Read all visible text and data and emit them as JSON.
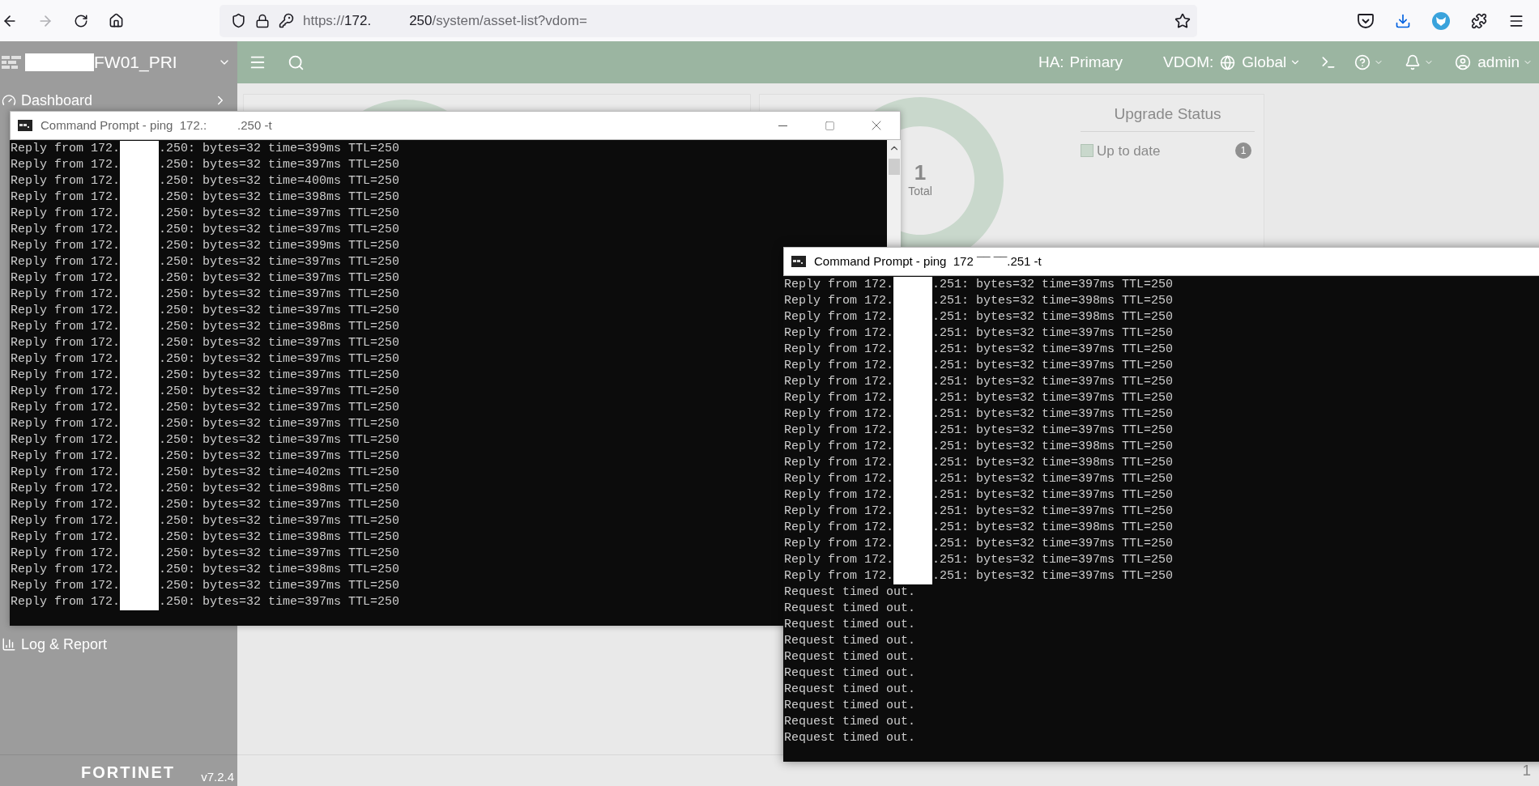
{
  "browser": {
    "forward_disabled": true,
    "url_scheme": "https://",
    "url_host_start": "172.",
    "url_host_end": "250",
    "url_path": "/system/asset-list?vdom="
  },
  "header": {
    "hostname": "FW01_PRI",
    "ha_label": "HA:",
    "ha_value": "Primary",
    "vdom_label": "VDOM:",
    "vdom_value": "Global",
    "user": "admin"
  },
  "sidebar": {
    "items": [
      {
        "label": "Dashboard"
      },
      {
        "label": "Log & Report"
      }
    ],
    "logo_text": "FORTINET",
    "version": "v7.2.4"
  },
  "upgrade_card": {
    "total": "1",
    "total_label": "Total",
    "legend_title": "Upgrade Status",
    "legend": [
      {
        "label": "Up to date",
        "count": "1",
        "checked": false
      }
    ]
  },
  "page_footer": {
    "count": "1"
  },
  "windows": [
    {
      "title_parts": [
        "Command Prompt - ping  172.:",
        ".250 -t"
      ],
      "active": false,
      "lines": [
        {
          "kind": "redacted",
          "start": "Reply from 172.",
          "end": ".250: bytes=32 time=399ms TTL=250"
        },
        {
          "kind": "redacted",
          "start": "Reply from 172.",
          "end": ".250: bytes=32 time=397ms TTL=250"
        },
        {
          "kind": "redacted",
          "start": "Reply from 172.",
          "end": ".250: bytes=32 time=400ms TTL=250"
        },
        {
          "kind": "redacted",
          "start": "Reply from 172.",
          "end": ".250: bytes=32 time=398ms TTL=250"
        },
        {
          "kind": "redacted",
          "start": "Reply from 172.",
          "end": ".250: bytes=32 time=397ms TTL=250"
        },
        {
          "kind": "redacted",
          "start": "Reply from 172.",
          "end": ".250: bytes=32 time=397ms TTL=250"
        },
        {
          "kind": "redacted",
          "start": "Reply from 172.",
          "end": ".250: bytes=32 time=399ms TTL=250"
        },
        {
          "kind": "redacted",
          "start": "Reply from 172.",
          "end": ".250: bytes=32 time=397ms TTL=250"
        },
        {
          "kind": "redacted",
          "start": "Reply from 172.",
          "end": ".250: bytes=32 time=397ms TTL=250"
        },
        {
          "kind": "redacted",
          "start": "Reply from 172.",
          "end": ".250: bytes=32 time=397ms TTL=250"
        },
        {
          "kind": "redacted",
          "start": "Reply from 172.",
          "end": ".250: bytes=32 time=397ms TTL=250"
        },
        {
          "kind": "redacted",
          "start": "Reply from 172.",
          "end": ".250: bytes=32 time=398ms TTL=250"
        },
        {
          "kind": "redacted",
          "start": "Reply from 172.",
          "end": ".250: bytes=32 time=397ms TTL=250"
        },
        {
          "kind": "redacted",
          "start": "Reply from 172.",
          "end": ".250: bytes=32 time=397ms TTL=250"
        },
        {
          "kind": "redacted",
          "start": "Reply from 172.",
          "end": ".250: bytes=32 time=397ms TTL=250"
        },
        {
          "kind": "redacted",
          "start": "Reply from 172.",
          "end": ".250: bytes=32 time=397ms TTL=250"
        },
        {
          "kind": "redacted",
          "start": "Reply from 172.",
          "end": ".250: bytes=32 time=397ms TTL=250"
        },
        {
          "kind": "redacted",
          "start": "Reply from 172.",
          "end": ".250: bytes=32 time=397ms TTL=250"
        },
        {
          "kind": "redacted",
          "start": "Reply from 172.",
          "end": ".250: bytes=32 time=397ms TTL=250"
        },
        {
          "kind": "redacted",
          "start": "Reply from 172.",
          "end": ".250: bytes=32 time=397ms TTL=250"
        },
        {
          "kind": "redacted",
          "start": "Reply from 172.",
          "end": ".250: bytes=32 time=402ms TTL=250"
        },
        {
          "kind": "redacted",
          "start": "Reply from 172.",
          "end": ".250: bytes=32 time=398ms TTL=250"
        },
        {
          "kind": "redacted",
          "start": "Reply from 172.",
          "end": ".250: bytes=32 time=397ms TTL=250"
        },
        {
          "kind": "redacted",
          "start": "Reply from 172.",
          "end": ".250: bytes=32 time=397ms TTL=250"
        },
        {
          "kind": "redacted",
          "start": "Reply from 172.",
          "end": ".250: bytes=32 time=398ms TTL=250"
        },
        {
          "kind": "redacted",
          "start": "Reply from 172.",
          "end": ".250: bytes=32 time=397ms TTL=250"
        },
        {
          "kind": "redacted",
          "start": "Reply from 172.",
          "end": ".250: bytes=32 time=398ms TTL=250"
        },
        {
          "kind": "redacted",
          "start": "Reply from 172.",
          "end": ".250: bytes=32 time=397ms TTL=250"
        },
        {
          "kind": "redacted",
          "start": "Reply from 172.",
          "end": ".250: bytes=32 time=397ms TTL=250"
        }
      ]
    },
    {
      "title_parts": [
        "Command Prompt - ping  172 ¯¯ ¯¯.251 -t"
      ],
      "active": true,
      "lines": [
        {
          "kind": "redacted",
          "start": "Reply from 172.",
          "end": ".251: bytes=32 time=397ms TTL=250"
        },
        {
          "kind": "redacted",
          "start": "Reply from 172.",
          "end": ".251: bytes=32 time=398ms TTL=250"
        },
        {
          "kind": "redacted",
          "start": "Reply from 172.",
          "end": ".251: bytes=32 time=398ms TTL=250"
        },
        {
          "kind": "redacted",
          "start": "Reply from 172.",
          "end": ".251: bytes=32 time=397ms TTL=250"
        },
        {
          "kind": "redacted",
          "start": "Reply from 172.",
          "end": ".251: bytes=32 time=397ms TTL=250"
        },
        {
          "kind": "redacted",
          "start": "Reply from 172.",
          "end": ".251: bytes=32 time=397ms TTL=250"
        },
        {
          "kind": "redacted",
          "start": "Reply from 172.",
          "end": ".251: bytes=32 time=397ms TTL=250"
        },
        {
          "kind": "redacted",
          "start": "Reply from 172.",
          "end": ".251: bytes=32 time=397ms TTL=250"
        },
        {
          "kind": "redacted",
          "start": "Reply from 172.",
          "end": ".251: bytes=32 time=397ms TTL=250"
        },
        {
          "kind": "redacted",
          "start": "Reply from 172.",
          "end": ".251: bytes=32 time=397ms TTL=250"
        },
        {
          "kind": "redacted",
          "start": "Reply from 172.",
          "end": ".251: bytes=32 time=398ms TTL=250"
        },
        {
          "kind": "redacted",
          "start": "Reply from 172.",
          "end": ".251: bytes=32 time=398ms TTL=250"
        },
        {
          "kind": "redacted",
          "start": "Reply from 172.",
          "end": ".251: bytes=32 time=397ms TTL=250"
        },
        {
          "kind": "redacted",
          "start": "Reply from 172.",
          "end": ".251: bytes=32 time=397ms TTL=250"
        },
        {
          "kind": "redacted",
          "start": "Reply from 172.",
          "end": ".251: bytes=32 time=397ms TTL=250"
        },
        {
          "kind": "redacted",
          "start": "Reply from 172.",
          "end": ".251: bytes=32 time=398ms TTL=250"
        },
        {
          "kind": "redacted",
          "start": "Reply from 172.",
          "end": ".251: bytes=32 time=397ms TTL=250"
        },
        {
          "kind": "redacted",
          "start": "Reply from 172.",
          "end": ".251: bytes=32 time=397ms TTL=250"
        },
        {
          "kind": "redacted",
          "start": "Reply from 172.",
          "end": ".251: bytes=32 time=397ms TTL=250"
        },
        {
          "kind": "plain",
          "text": "Request timed out."
        },
        {
          "kind": "plain",
          "text": "Request timed out."
        },
        {
          "kind": "plain",
          "text": "Request timed out."
        },
        {
          "kind": "plain",
          "text": "Request timed out."
        },
        {
          "kind": "plain",
          "text": "Request timed out."
        },
        {
          "kind": "plain",
          "text": "Request timed out."
        },
        {
          "kind": "plain",
          "text": "Request timed out."
        },
        {
          "kind": "plain",
          "text": "Request timed out."
        },
        {
          "kind": "plain",
          "text": "Request timed out."
        },
        {
          "kind": "plain",
          "text": "Request timed out."
        }
      ]
    }
  ]
}
